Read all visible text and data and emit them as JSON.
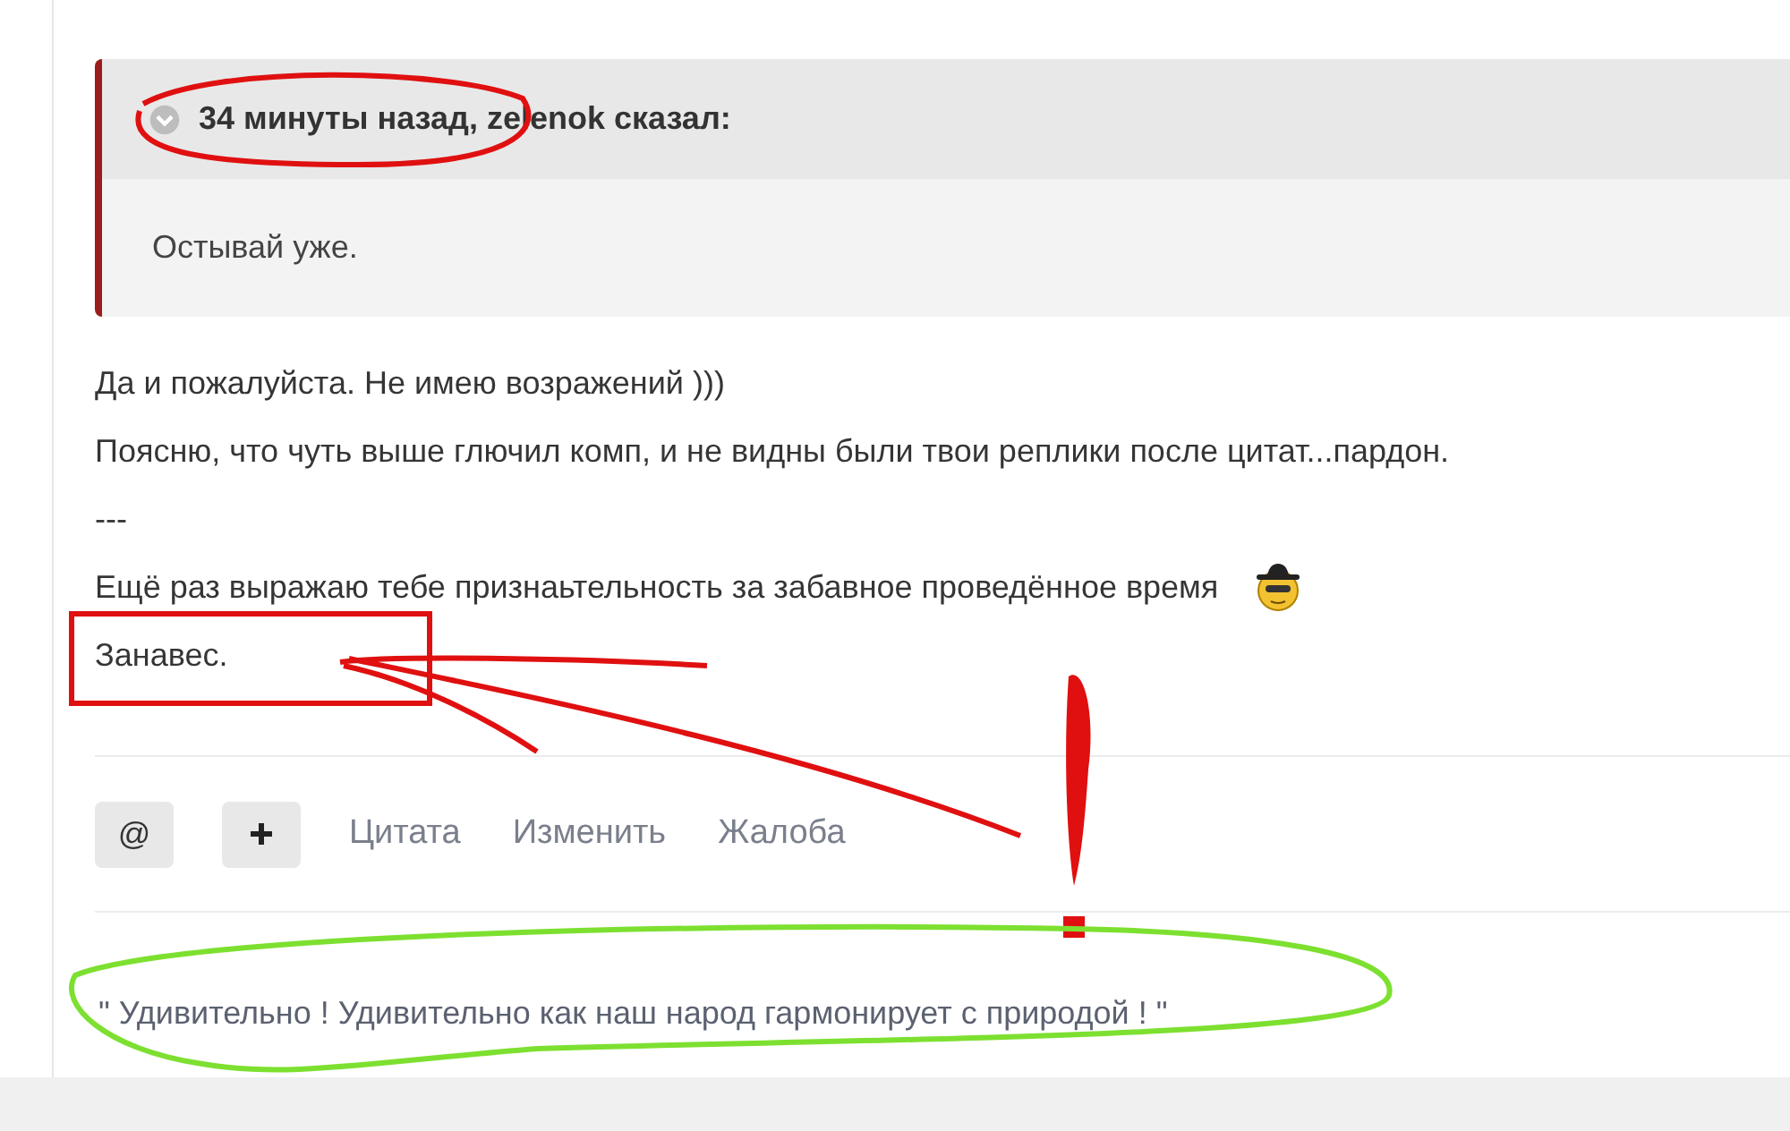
{
  "quote": {
    "header": "34 минуты назад, zelenok сказал:",
    "text": "Остывай уже."
  },
  "paragraphs": [
    {
      "text": "Да и пожалуйста. Не имею возражений )))",
      "emoji": false
    },
    {
      "text": "Поясню, что чуть выше глючил комп, и не видны были твои реплики после цитат...пардон.",
      "emoji": false
    },
    {
      "text": "---",
      "emoji": false
    },
    {
      "text": "Ещё раз выражаю тебе признаьтельность за забавное проведённое время",
      "emoji": true
    },
    {
      "text": "Занавес.",
      "emoji": false
    }
  ],
  "actions": {
    "mention": "@",
    "links": [
      "Цитата",
      "Изменить",
      "Жалоба"
    ]
  },
  "signature": "\" Удивительно ! Удивительно как наш народ гармонирует с природой ! \""
}
